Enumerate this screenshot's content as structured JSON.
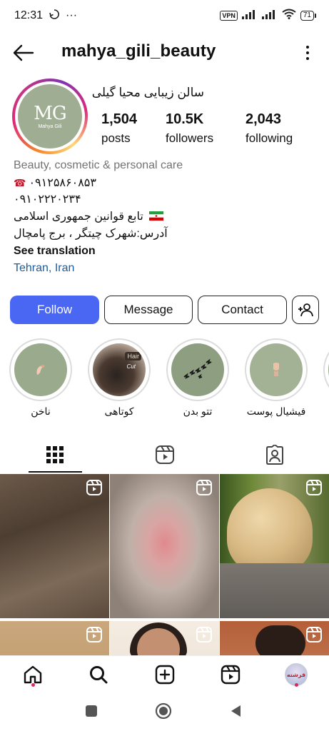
{
  "status_bar": {
    "time": "12:31",
    "extra": "···",
    "vpn": "VPN",
    "battery": "71"
  },
  "header": {
    "username": "mahya_gili_beauty"
  },
  "profile": {
    "avatar_logo": "MG",
    "avatar_subtext": "Mahya Gili",
    "full_name": "سالن زیبایی محیا گیلی",
    "stats": {
      "posts": {
        "value": "1,504",
        "label": "posts"
      },
      "followers": {
        "value": "10.5K",
        "label": "followers"
      },
      "following": {
        "value": "2,043",
        "label": "following"
      }
    }
  },
  "bio": {
    "category": "Beauty, cosmetic & personal care",
    "phone1": "۰۹۱۲۵۸۶۰۸۵۳",
    "phone2": "۰۹۱۰۲۲۲۰۲۳۴",
    "law_line": "تابع قوانین جمهوری اسلامی",
    "address": "آدرس:شهرک چیتگر ، برج پامچال",
    "see_translation": "See translation",
    "location": "Tehran, Iran"
  },
  "actions": {
    "follow": "Follow",
    "message": "Message",
    "contact": "Contact"
  },
  "highlights": [
    {
      "label": "ناخن",
      "icon": "nail-icon"
    },
    {
      "label": "کوتاهی",
      "icon": "haircut-photo",
      "tag1": "Hair",
      "tag2": "Cut"
    },
    {
      "label": "تتو بدن",
      "icon": "birds-icon"
    },
    {
      "label": "فیشیال پوست",
      "icon": "facial-icon"
    },
    {
      "label": "ف",
      "icon": "partial"
    }
  ],
  "tabs": [
    "grid-icon",
    "reels-icon",
    "tagged-icon"
  ],
  "bottom_nav": [
    "home-icon",
    "search-icon",
    "create-icon",
    "reels-icon",
    "profile-avatar"
  ],
  "profile_thumb_text": "قرشته",
  "colors": {
    "follow_button": "#4a67f4",
    "link": "#1d5c9c",
    "avatar_bg": "#9fae92",
    "notification_dot": "#e0245e"
  }
}
